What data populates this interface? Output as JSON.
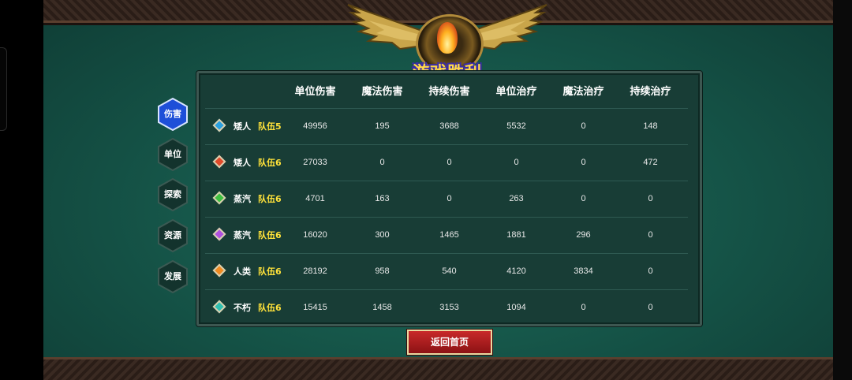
{
  "title": "游戏胜利",
  "tabs": [
    {
      "label": "伤害",
      "active": true
    },
    {
      "label": "单位",
      "active": false
    },
    {
      "label": "探索",
      "active": false
    },
    {
      "label": "资源",
      "active": false
    },
    {
      "label": "发展",
      "active": false
    }
  ],
  "columns": [
    "单位伤害",
    "魔法伤害",
    "持续伤害",
    "单位治疗",
    "魔法治疗",
    "持续治疗"
  ],
  "rows": [
    {
      "race": "矮人",
      "team": "队伍5",
      "gem_color": "#2aa0e0",
      "values": [
        "49956",
        "195",
        "3688",
        "5532",
        "0",
        "148"
      ]
    },
    {
      "race": "矮人",
      "team": "队伍6",
      "gem_color": "#e04a2a",
      "values": [
        "27033",
        "0",
        "0",
        "0",
        "0",
        "472"
      ]
    },
    {
      "race": "蒸汽",
      "team": "队伍6",
      "gem_color": "#3ec040",
      "values": [
        "4701",
        "163",
        "0",
        "263",
        "0",
        "0"
      ]
    },
    {
      "race": "蒸汽",
      "team": "队伍6",
      "gem_color": "#b050e0",
      "values": [
        "16020",
        "300",
        "1465",
        "1881",
        "296",
        "0"
      ]
    },
    {
      "race": "人类",
      "team": "队伍6",
      "gem_color": "#f08a20",
      "values": [
        "28192",
        "958",
        "540",
        "4120",
        "3834",
        "0"
      ]
    },
    {
      "race": "不朽",
      "team": "队伍6",
      "gem_color": "#30c0b0",
      "values": [
        "15415",
        "1458",
        "3153",
        "1094",
        "0",
        "0"
      ]
    }
  ],
  "return_button": "返回首页",
  "colors": {
    "team_text": "#ffe23a",
    "active_tab": "#1e4fd8",
    "button": "#c8292a"
  }
}
